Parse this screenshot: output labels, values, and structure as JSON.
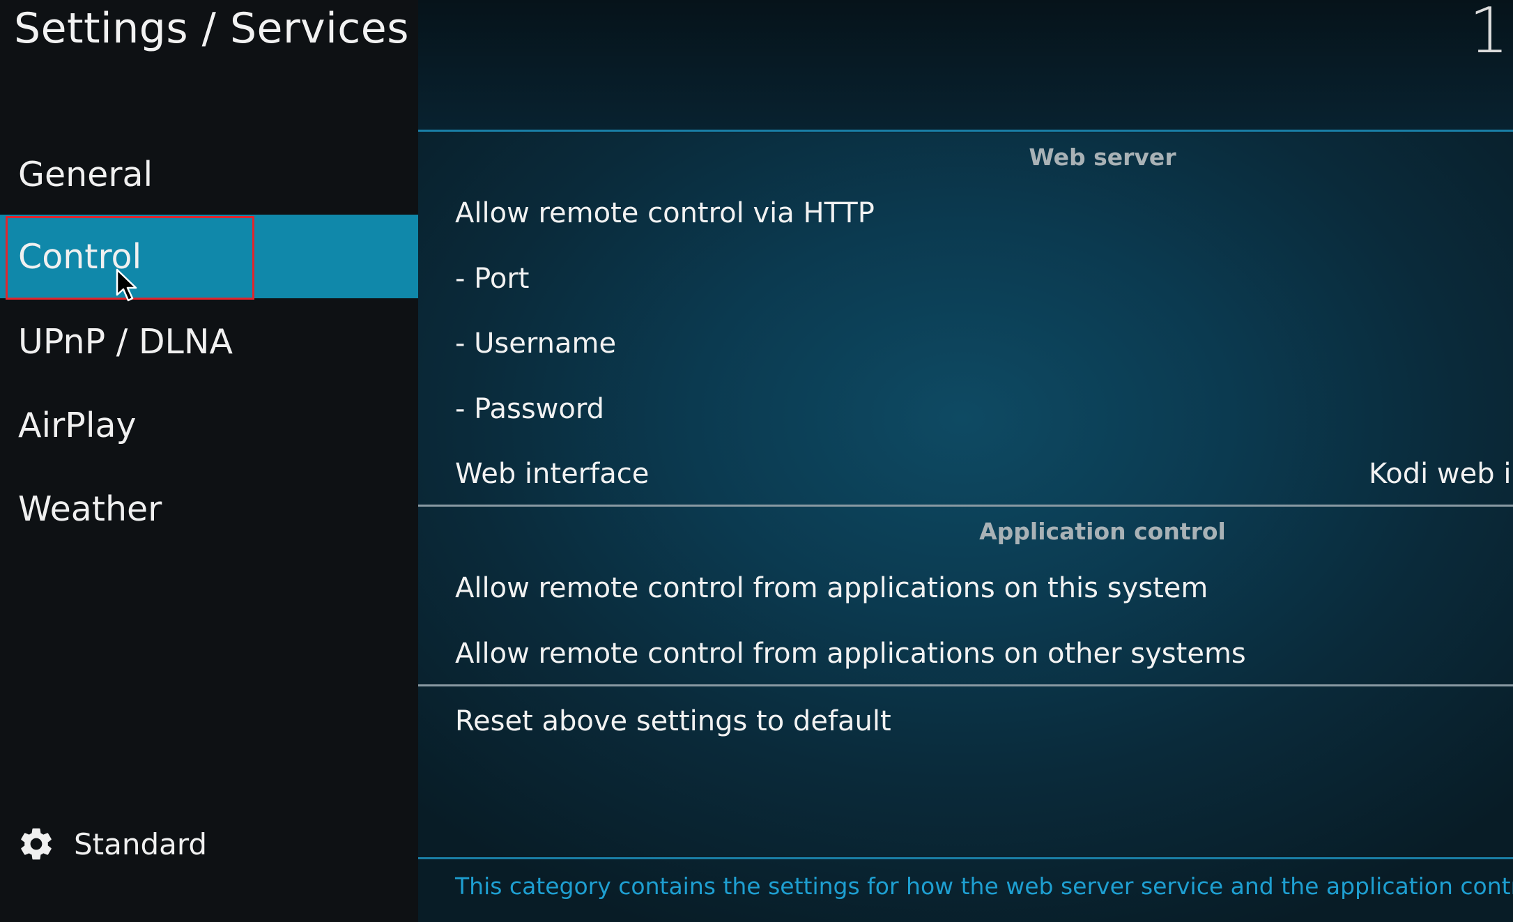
{
  "header": {
    "title": "Settings / Services",
    "clock": "1"
  },
  "categories": [
    {
      "label": "General"
    },
    {
      "label": "Control"
    },
    {
      "label": "UPnP / DLNA"
    },
    {
      "label": "AirPlay"
    },
    {
      "label": "Weather"
    }
  ],
  "level": {
    "icon": "gear-icon",
    "label": "Standard"
  },
  "groups": {
    "web_server": {
      "title": "Web server",
      "items": [
        {
          "label": "Allow remote control via HTTP"
        },
        {
          "label": "- Port"
        },
        {
          "label": "- Username"
        },
        {
          "label": "- Password"
        },
        {
          "label": "Web interface",
          "value": "Kodi web in"
        }
      ]
    },
    "app_control": {
      "title": "Application control",
      "items": [
        {
          "label": "Allow remote control from applications on this system"
        },
        {
          "label": "Allow remote control from applications on other systems"
        }
      ]
    },
    "reset": {
      "label": "Reset above settings to default"
    }
  },
  "description": "This category contains the settings for how the web server service and the application control service is",
  "colors": {
    "accent": "#1088aa",
    "highlight_box": "#e0252d",
    "description_text": "#1e9fd1"
  }
}
